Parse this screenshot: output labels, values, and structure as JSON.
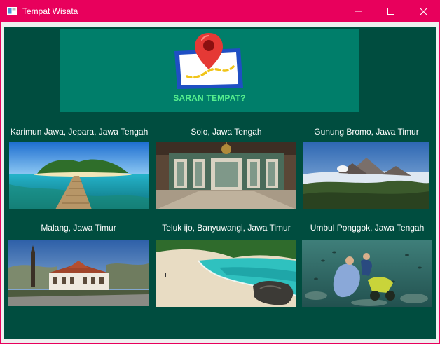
{
  "window": {
    "title": "Tempat Wisata",
    "icon": "window-app-icon",
    "controls": [
      "minimize-icon",
      "maximize-icon",
      "close-icon"
    ]
  },
  "header": {
    "logo_icon": "map-pin-icon",
    "title": "SARAN TEMPAT?"
  },
  "places": [
    {
      "label": "Karimun Jawa, Jepara, Jawa Tengah",
      "image": "island-pier-photo"
    },
    {
      "label": "Solo, Jawa Tengah",
      "image": "palace-hall-photo"
    },
    {
      "label": "Gunung Bromo, Jawa Timur",
      "image": "volcano-photo"
    },
    {
      "label": "Malang, Jawa Timur",
      "image": "colonial-building-photo"
    },
    {
      "label": "Teluk ijo, Banyuwangi, Jawa Timur",
      "image": "green-bay-beach-photo"
    },
    {
      "label": "Umbul Ponggok, Jawa Tengah",
      "image": "underwater-scooter-photo"
    }
  ],
  "colors": {
    "titlebar": "#e8005c",
    "background": "#004d3f",
    "header_panel": "#007e6a",
    "header_text": "#55ef8e"
  }
}
